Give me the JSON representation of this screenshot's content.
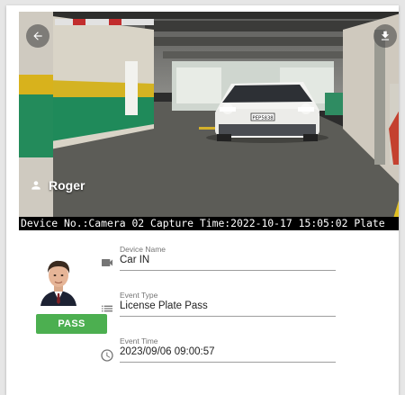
{
  "photo": {
    "person_name": "Roger",
    "plate_text": "PEP5838",
    "capture_caption": "Device No.:Camera 02 Capture Time:2022-10-17 15:05:02 Plate",
    "back_icon": "arrow-back-icon",
    "download_icon": "download-icon",
    "person_icon": "person-icon"
  },
  "status": {
    "badge": "PASS",
    "badge_color": "#4caf50"
  },
  "fields": [
    {
      "label": "Device Name",
      "value": "Car IN",
      "icon": "videocam-icon"
    },
    {
      "label": "Event Type",
      "value": "License Plate Pass",
      "icon": "list-icon"
    },
    {
      "label": "Event Time",
      "value": "2023/09/06 09:00:57",
      "icon": "clock-icon"
    }
  ]
}
